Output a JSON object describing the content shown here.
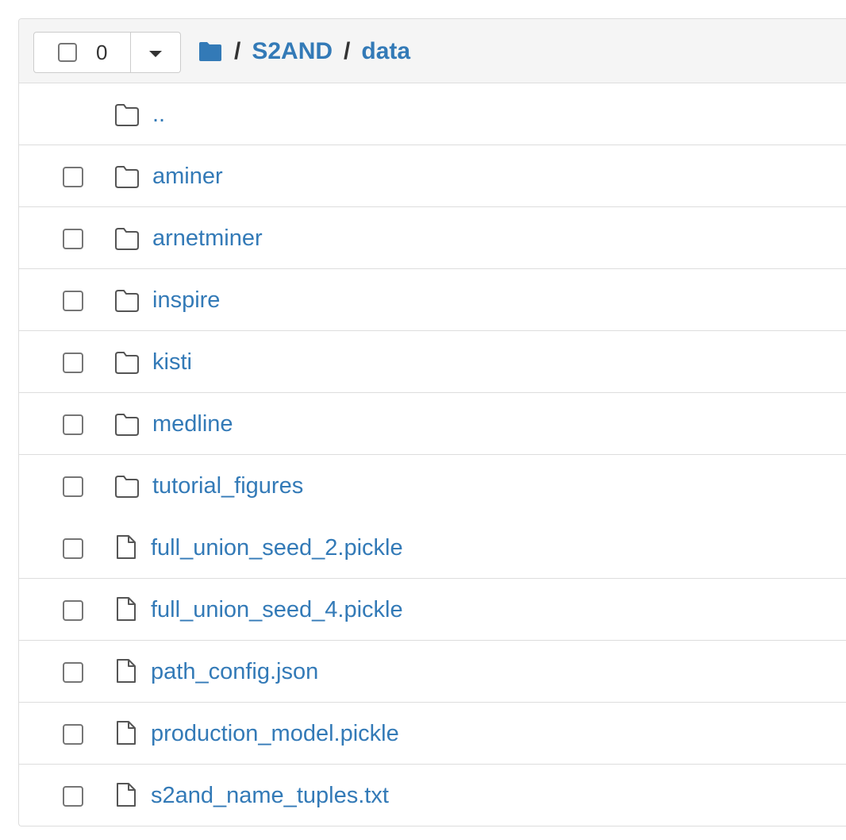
{
  "toolbar": {
    "selected_count": "0"
  },
  "breadcrumb": {
    "separator": "/",
    "items": [
      "S2AND",
      "data"
    ]
  },
  "parent_row": {
    "label": ".."
  },
  "folders": [
    {
      "name": "aminer"
    },
    {
      "name": "arnetminer"
    },
    {
      "name": "inspire"
    },
    {
      "name": "kisti"
    },
    {
      "name": "medline"
    },
    {
      "name": "tutorial_figures"
    }
  ],
  "files": [
    {
      "name": "full_union_seed_2.pickle"
    },
    {
      "name": "full_union_seed_4.pickle"
    },
    {
      "name": "path_config.json"
    },
    {
      "name": "production_model.pickle"
    },
    {
      "name": "s2and_name_tuples.txt"
    }
  ],
  "colors": {
    "link": "#337ab7",
    "header_bg": "#f5f5f5",
    "border": "#dddddd",
    "folder_icon_solid": "#337ab7"
  }
}
